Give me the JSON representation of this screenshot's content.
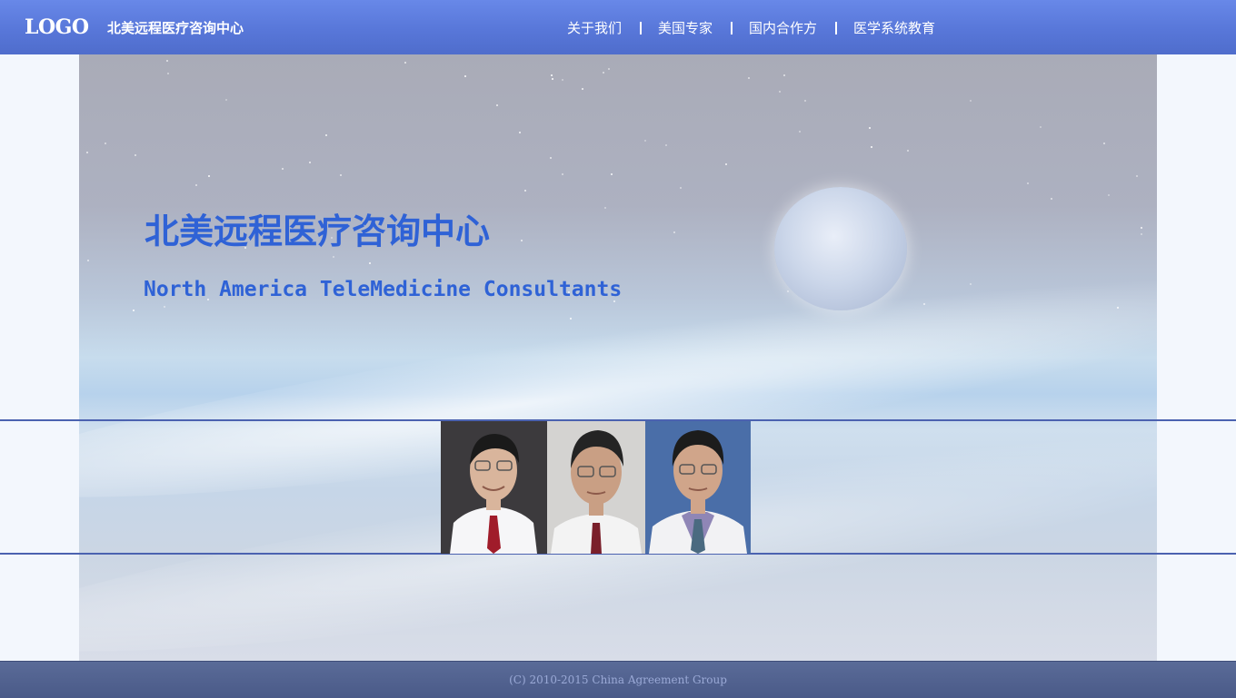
{
  "header": {
    "logo": "LOGO",
    "brand": "北美远程医疗咨询中心",
    "nav": [
      {
        "label": "关于我们"
      },
      {
        "label": "美国专家"
      },
      {
        "label": "国内合作方"
      },
      {
        "label": "医学系统教育"
      }
    ]
  },
  "hero": {
    "title": "北美远程医疗咨询中心",
    "subtitle": "North America TeleMedicine Consultants"
  },
  "experts": [
    {
      "photo": "expert-photo-1",
      "background": "#3c3a3d",
      "skin": "#d9b59c",
      "shirt": "#f6f6f8",
      "tie": "#a01c2a",
      "hair": "#1a1a1a"
    },
    {
      "photo": "expert-photo-2",
      "background": "#d4d3d1",
      "skin": "#c99f84",
      "shirt": "#f3f3f3",
      "tie": "#7a1f2a",
      "hair": "#242424"
    },
    {
      "photo": "expert-photo-3",
      "background": "#4a6ea8",
      "skin": "#d0a58a",
      "shirt": "#f2f2f4",
      "tie": "#4a6a80",
      "hair": "#1c1c1c"
    }
  ],
  "footer": {
    "copyright": "(C) 2010-2015 China Agreement Group"
  },
  "colors": {
    "header_bg": "#5a79dc",
    "accent_text": "#2f62d6",
    "footer_bg": "#4f5f8c",
    "strip_line": "#4b62b0"
  }
}
